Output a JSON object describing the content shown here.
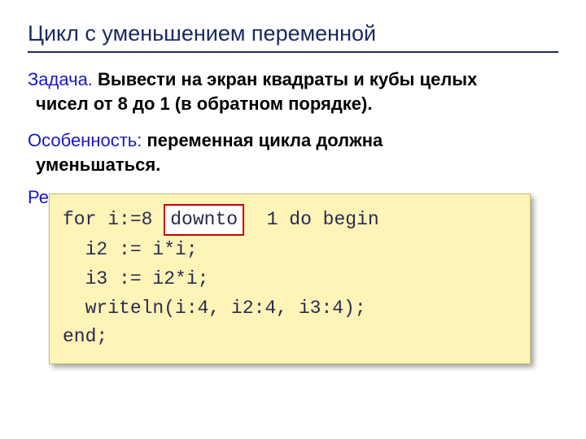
{
  "title": "Цикл с уменьшением переменной",
  "task": {
    "label": "Задача.",
    "text1": " Вывести на экран квадраты и кубы целых",
    "text2": "чисел от 8 до 1 (в обратном порядке)."
  },
  "feature": {
    "label": "Особенность:",
    "text1": " переменная цикла должна",
    "text2": "уменьшаться."
  },
  "solution": {
    "label": "Решение:"
  },
  "code": {
    "line1a": "for i:=8 ",
    "line1_hl": "downto",
    "line1b": "  1 do begin",
    "line2": "  i2 := i*i;",
    "line3": "  i3 := i2*i;",
    "line4": "  writeln(i:4, i2:4, i3:4);",
    "line5": "end;"
  }
}
